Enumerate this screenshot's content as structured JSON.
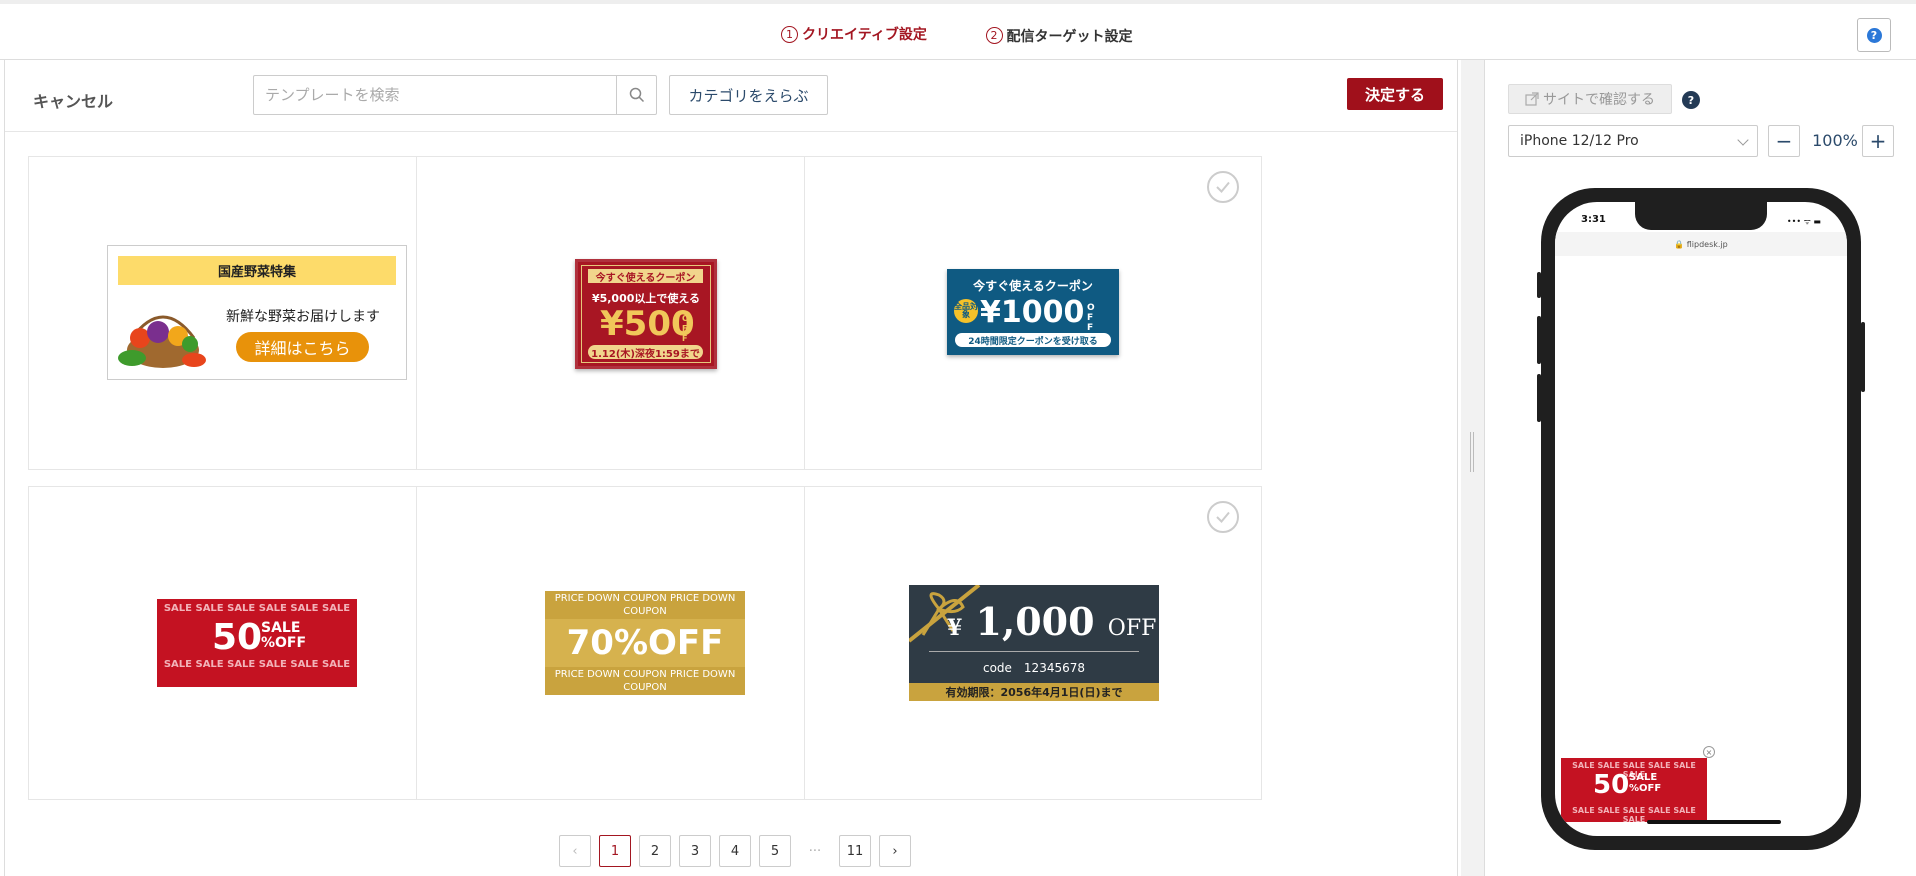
{
  "steps": [
    {
      "num": "1",
      "label": "クリエイティブ設定"
    },
    {
      "num": "2",
      "label": "配信ターゲット設定"
    }
  ],
  "help_label": "?",
  "toolbar": {
    "cancel": "キャンセル",
    "search_placeholder": "テンプレートを検索",
    "category": "カテゴリをえらぶ",
    "decide": "決定する"
  },
  "templates": [
    {
      "title": "国産野菜特集",
      "text": "新鮮な野菜お届けします",
      "button": "詳細はこちら",
      "selected": false
    },
    {
      "top": "今すぐ使えるクーポン",
      "cond": "¥5,000以上で使える",
      "amount": "¥500",
      "off": "OFF",
      "deadline": "1.12(木)深夜1:59まで",
      "selected": false
    },
    {
      "top": "今すぐ使えるクーポン",
      "badge": "全品対象",
      "amount": "¥1000",
      "off": "OFF",
      "note": "24時間限定クーポンを受け取る",
      "selected": false
    },
    {
      "row": "SALE SALE SALE SALE SALE SALE",
      "num": "50",
      "sale": "SALE",
      "pctoff": "%OFF",
      "selected": true
    },
    {
      "row1": "PRICE DOWN COUPON PRICE DOWN COUPON",
      "big": "70%OFF",
      "row2": "PRICE DOWN COUPON PRICE DOWN COUPON",
      "selected": false
    },
    {
      "yen": "¥",
      "amount": "1,000",
      "off": "OFF",
      "code": "code　12345678",
      "expiry": "有効期限：2056年4月1日(日)まで",
      "selected": false
    }
  ],
  "pagination": {
    "prev": "‹",
    "pages": [
      "1",
      "2",
      "3",
      "4",
      "5"
    ],
    "dots": "···",
    "last": "11",
    "next": "›",
    "current": "1"
  },
  "preview": {
    "site_button": "サイトで確認する",
    "help": "?",
    "device": "iPhone 12/12 Pro",
    "zoom_out": "−",
    "zoom": "100%",
    "zoom_in": "+",
    "time": "3:31",
    "status": "••• ᯤ ▬",
    "address": "🔒 flipdesk.jp",
    "banner": {
      "row": "SALE SALE SALE SALE SALE SALE",
      "num": "50",
      "sale": "SALE",
      "pctoff": "%OFF"
    },
    "close": "×"
  },
  "colors": {
    "accent": "#a31621",
    "selected": "#4caf21"
  }
}
